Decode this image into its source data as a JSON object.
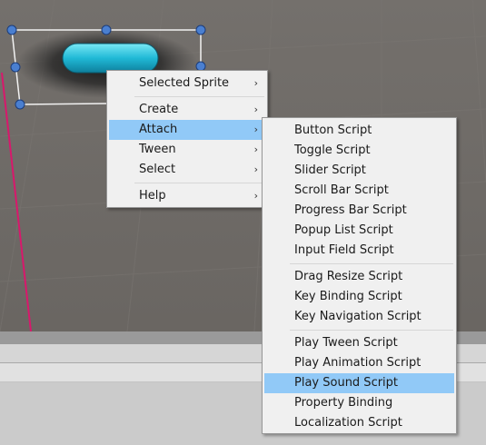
{
  "colors": {
    "highlight": "#91c9f7",
    "menu_bg": "#f0f0f0",
    "scene_bg": "#6e6a66",
    "gizmo_handle": "#4a7fd0",
    "button_glow": "#36d0e6",
    "axis_line": "#d8186c"
  },
  "context_menu": {
    "items": [
      {
        "label": "Selected Sprite",
        "has_submenu": true
      },
      {
        "label": "Create",
        "has_submenu": true
      },
      {
        "label": "Attach",
        "has_submenu": true,
        "highlighted": true
      },
      {
        "label": "Tween",
        "has_submenu": true
      },
      {
        "label": "Select",
        "has_submenu": true
      },
      {
        "label": "Help",
        "has_submenu": true
      }
    ],
    "arrow_glyph": "›"
  },
  "attach_submenu": {
    "items": [
      {
        "label": "Button Script"
      },
      {
        "label": "Toggle Script"
      },
      {
        "label": "Slider Script"
      },
      {
        "label": "Scroll Bar Script"
      },
      {
        "label": "Progress Bar Script"
      },
      {
        "label": "Popup List Script"
      },
      {
        "label": "Input Field Script"
      },
      {
        "label": "Drag Resize Script"
      },
      {
        "label": "Key Binding Script"
      },
      {
        "label": "Key Navigation Script"
      },
      {
        "label": "Play Tween Script"
      },
      {
        "label": "Play Animation Script"
      },
      {
        "label": "Play Sound Script",
        "highlighted": true
      },
      {
        "label": "Property Binding"
      },
      {
        "label": "Localization Script"
      }
    ]
  }
}
